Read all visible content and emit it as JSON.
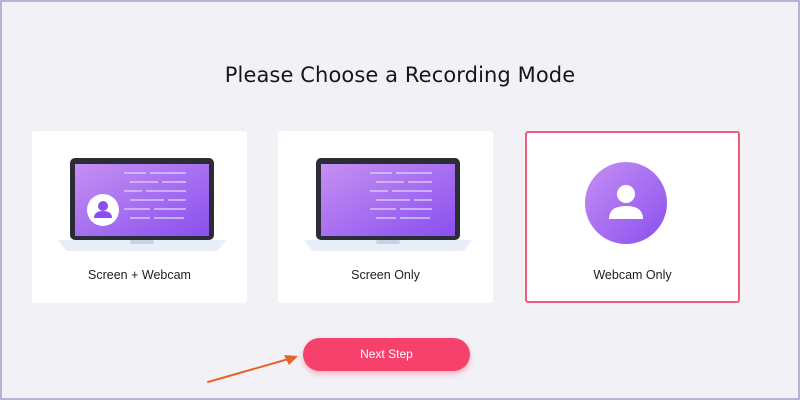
{
  "page": {
    "title": "Please Choose a Recording Mode"
  },
  "modes": [
    {
      "label": "Screen + Webcam",
      "icon": "laptop-with-avatar-icon",
      "selected": false
    },
    {
      "label": "Screen Only",
      "icon": "laptop-icon",
      "selected": false
    },
    {
      "label": "Webcam Only",
      "icon": "user-avatar-icon",
      "selected": true
    }
  ],
  "actions": {
    "next_label": "Next Step"
  },
  "colors": {
    "accent": "#f5416b",
    "selected_border": "#f05a7e",
    "gradient_start": "#c590f2",
    "gradient_end": "#8a4ff0",
    "annotation_arrow": "#e8622a"
  }
}
